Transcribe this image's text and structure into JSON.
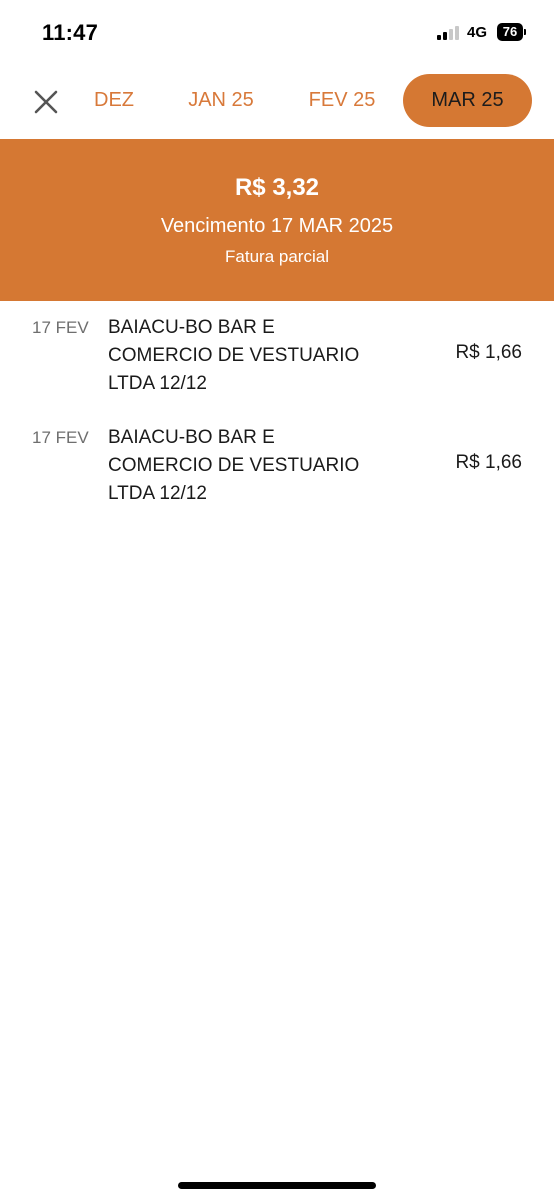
{
  "status_bar": {
    "time": "11:47",
    "network": "4G",
    "battery": "76"
  },
  "month_nav": {
    "close_icon": "close-icon",
    "tabs": [
      {
        "label": "DEZ",
        "active": false
      },
      {
        "label": "JAN 25",
        "active": false
      },
      {
        "label": "FEV 25",
        "active": false
      },
      {
        "label": "MAR 25",
        "active": true
      }
    ],
    "accent_color": "#d57833"
  },
  "summary": {
    "amount": "R$ 3,32",
    "due": "Vencimento 17 MAR 2025",
    "status": "Fatura parcial"
  },
  "transactions": [
    {
      "date": "17 FEV",
      "description_lines": [
        "BAIACU-BO BAR E",
        "COMERCIO DE VESTUARIO",
        "LTDA 12/12"
      ],
      "amount": "R$ 1,66"
    },
    {
      "date": "17 FEV",
      "description_lines": [
        "BAIACU-BO BAR E",
        "COMERCIO DE VESTUARIO",
        "LTDA 12/12"
      ],
      "amount": "R$ 1,66"
    }
  ]
}
